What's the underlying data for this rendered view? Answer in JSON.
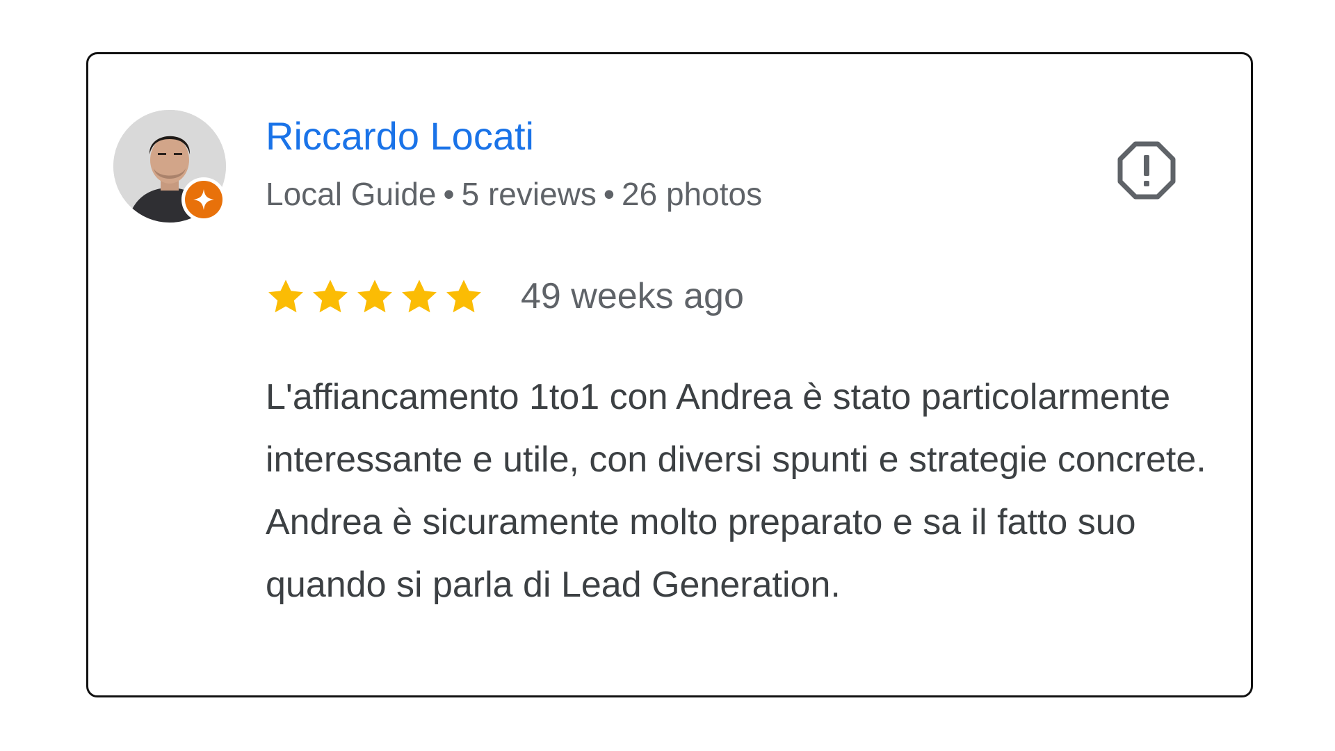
{
  "review": {
    "author_name": "Riccardo Locati",
    "badge": "Local Guide",
    "reviews_count": "5 reviews",
    "photos_count": "26 photos",
    "separator": "•",
    "rating": 5,
    "rating_max": 5,
    "time_ago": "49 weeks ago",
    "text": "L'affiancamento 1to1 con Andrea è stato particolarmente interessante e utile, con diversi spunti e strategie concrete. Andrea è sicuramente molto preparato e sa il fatto suo quando si parla di Lead Generation."
  },
  "icons": {
    "avatar": "user-avatar",
    "badge": "local-guide-badge-icon",
    "report": "report-flag-icon",
    "star": "star-icon"
  },
  "colors": {
    "name": "#1a73e8",
    "star": "#fbbc04",
    "badge": "#e8710a",
    "meta": "#5f6368",
    "border": "#111111"
  }
}
